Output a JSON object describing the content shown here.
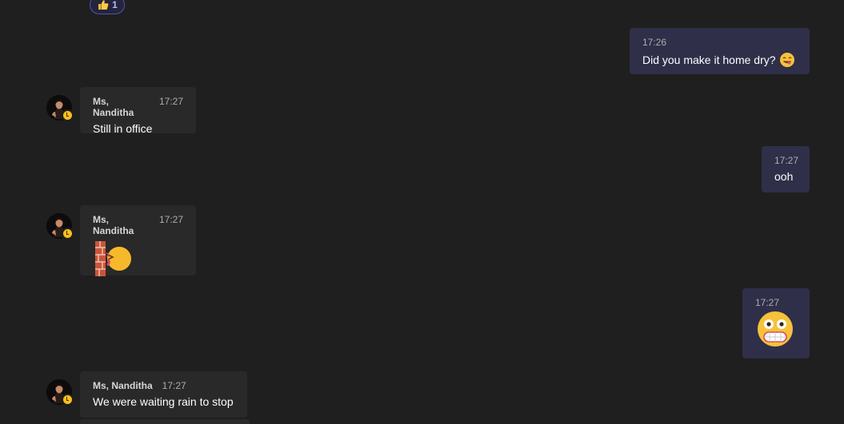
{
  "reaction": {
    "icon": "thumbs-up-icon",
    "count": "1"
  },
  "messages": [
    {
      "side": "mine",
      "time": "17:26",
      "text": "Did you make it home dry?",
      "emoji": "yum-face-emoji"
    },
    {
      "side": "theirs",
      "sender": "Ms, Nanditha",
      "time": "17:27",
      "text": "Still in office"
    },
    {
      "side": "mine",
      "time": "17:27",
      "text": "ooh"
    },
    {
      "side": "theirs",
      "sender": "Ms, Nanditha",
      "time": "17:27",
      "emoji": "head-bang-wall-emoji"
    },
    {
      "side": "mine",
      "time": "17:27",
      "emoji": "grimacing-face-emoji"
    },
    {
      "side": "theirs",
      "sender": "Ms, Nanditha",
      "time": "17:27",
      "text": "We were waiting rain to stop"
    }
  ],
  "colors": {
    "background": "#1f1f1f",
    "mine_bubble": "#2f2f4a",
    "theirs_bubble": "#292929",
    "presence_away": "#f8c01c"
  }
}
